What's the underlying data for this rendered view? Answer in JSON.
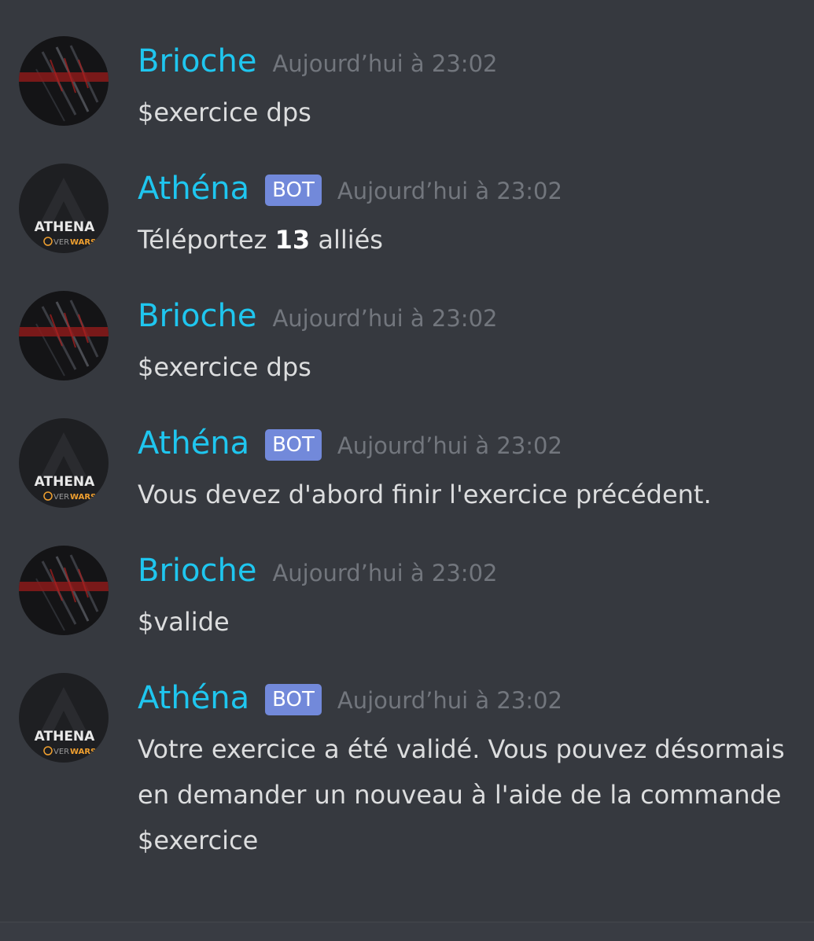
{
  "users": {
    "brioche": {
      "name": "Brioche",
      "name_color": "#1fc6ef",
      "avatar_icon": "claw-scratch-avatar"
    },
    "athena": {
      "name": "Athéna",
      "name_color": "#1fc6ef",
      "avatar_icon": "athena-overwars-avatar",
      "avatar_title": "ATHENA",
      "avatar_sub_prefix": "VER",
      "avatar_sub_suffix": "WARS"
    }
  },
  "bot_tag": "BOT",
  "messages": [
    {
      "author": "Brioche",
      "timestamp": "Aujourd’hui à 23:02",
      "text": "$exercice dps"
    },
    {
      "author": "Athéna",
      "bot": true,
      "timestamp": "Aujourd’hui à 23:02",
      "text_before": "Téléportez ",
      "text_bold": "13",
      "text_after": " alliés"
    },
    {
      "author": "Brioche",
      "timestamp": "Aujourd’hui à 23:02",
      "text": "$exercice dps"
    },
    {
      "author": "Athéna",
      "bot": true,
      "timestamp": "Aujourd’hui à 23:02",
      "text": "Vous devez d'abord finir l'exercice précédent."
    },
    {
      "author": "Brioche",
      "timestamp": "Aujourd’hui à 23:02",
      "text": "$valide"
    },
    {
      "author": "Athéna",
      "bot": true,
      "timestamp": "Aujourd’hui à 23:02",
      "text": "Votre exercice a été validé. Vous pouvez désormais en demander un nouveau à l'aide de la commande $exercice"
    }
  ],
  "colors": {
    "background": "#36393f",
    "bot_tag": "#7289da",
    "timestamp": "#72767d",
    "message_text": "#dcddde"
  }
}
